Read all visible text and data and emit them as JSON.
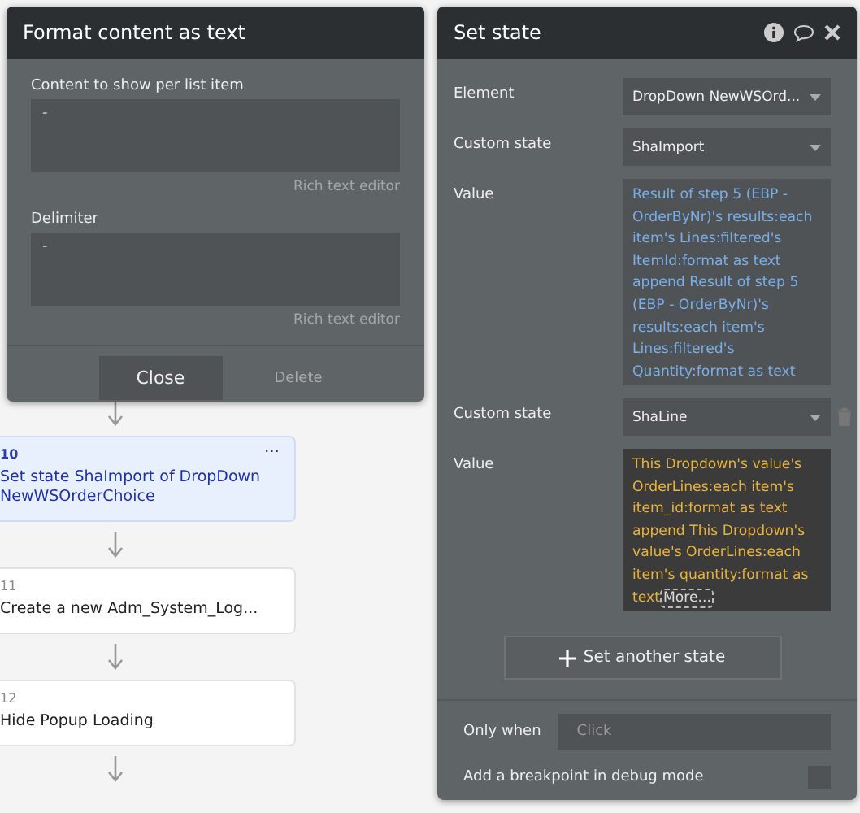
{
  "workflow_steps": [
    {
      "number": "10",
      "title": "Set state ShaImport of DropDown NewWSOrderChoice",
      "selected": true,
      "menu": "..."
    },
    {
      "number": "11",
      "title": "Create a new Adm_System_Log...",
      "selected": false
    },
    {
      "number": "12",
      "title": "Hide Popup Loading",
      "selected": false
    }
  ],
  "format_panel": {
    "title": "Format content as text",
    "fields": [
      {
        "label": "Content to show per list item",
        "value": "-",
        "hint": "Rich text editor"
      },
      {
        "label": "Delimiter",
        "value": "-",
        "hint": "Rich text editor"
      }
    ],
    "buttons": [
      {
        "label": "Close",
        "kind": "primary"
      },
      {
        "label": "Delete",
        "kind": "link"
      }
    ]
  },
  "set_state_panel": {
    "title": "Set state",
    "rows": [
      {
        "kind": "dropdown",
        "label": "Element",
        "value": "DropDown NewWSOrd..."
      },
      {
        "kind": "dropdown",
        "label": "Custom state",
        "value": "ShaImport"
      },
      {
        "kind": "expression",
        "label": "Value",
        "value": "Result of step 5 (EBP - OrderByNr)'s results:each item's Lines:filtered's ItemId:format as text append Result of step 5 (EBP - OrderByNr)'s results:each item's Lines:filtered's Quantity:format as text",
        "focused": false
      },
      {
        "kind": "dropdown",
        "label": "Custom state",
        "value": "ShaLine",
        "deletable": true
      },
      {
        "kind": "expression",
        "label": "Value",
        "value": "This Dropdown's value's OrderLines:each item's item_id:format as text append This Dropdown's value's OrderLines:each item's quantity:format as text",
        "more": "More...",
        "focused": true
      }
    ],
    "add_button": "Set another state",
    "only_when": {
      "label": "Only when",
      "placeholder": "Click"
    },
    "breakpoint": {
      "label": "Add a breakpoint in debug mode",
      "checked": false
    }
  }
}
